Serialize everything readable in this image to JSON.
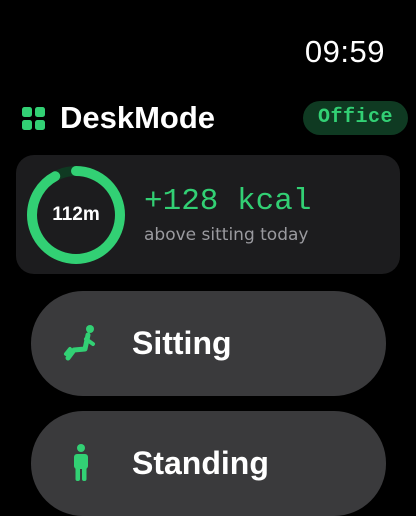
{
  "status": {
    "time": "09:59"
  },
  "header": {
    "app_icon": "grid-icon",
    "title": "DeskMode",
    "badge": "Office"
  },
  "summary": {
    "ring_label": "112m",
    "ring_progress": 0.92,
    "kcal": "+128 kcal",
    "kcal_caption": "above sitting today"
  },
  "modes": [
    {
      "label": "Sitting",
      "icon": "sitting-person-icon"
    },
    {
      "label": "Standing",
      "icon": "standing-person-icon"
    }
  ],
  "colors": {
    "accent": "#32d074",
    "badge_bg": "#0f3a22",
    "card_bg": "#1c1c1e",
    "button_bg": "#3a3a3c",
    "ring_track": "#0f3a22",
    "secondary_text": "#9a9a9f"
  }
}
